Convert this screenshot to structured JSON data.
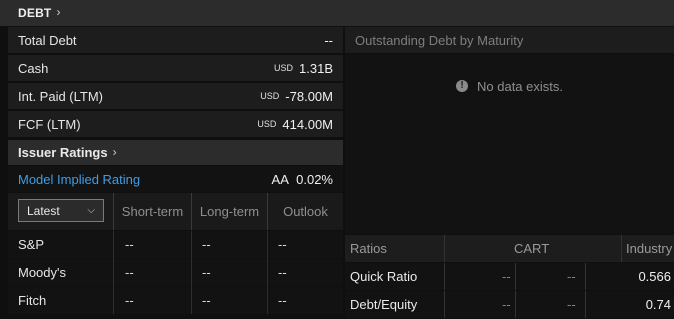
{
  "debt_header": {
    "title": "DEBT",
    "chevron": "›"
  },
  "metrics": [
    {
      "label": "Total Debt",
      "currency": "",
      "value": "--"
    },
    {
      "label": "Cash",
      "currency": "USD",
      "value": "1.31B"
    },
    {
      "label": "Int. Paid (LTM)",
      "currency": "USD",
      "value": "-78.00M"
    },
    {
      "label": "FCF (LTM)",
      "currency": "USD",
      "value": "414.00M"
    }
  ],
  "issuer_ratings": {
    "title": "Issuer Ratings",
    "chevron": "›",
    "model_implied": {
      "label": "Model Implied Rating",
      "rating": "AA",
      "pct": "0.02%"
    },
    "period_select": {
      "value": "Latest",
      "arrow": "⌵"
    },
    "columns": [
      "Short-term",
      "Long-term",
      "Outlook"
    ],
    "rows": [
      {
        "agency": "S&P",
        "short": "--",
        "long": "--",
        "outlook": "--"
      },
      {
        "agency": "Moody's",
        "short": "--",
        "long": "--",
        "outlook": "--"
      },
      {
        "agency": "Fitch",
        "short": "--",
        "long": "--",
        "outlook": "--"
      }
    ]
  },
  "outstanding_debt": {
    "title": "Outstanding Debt by Maturity",
    "empty_message": "No data exists.",
    "icon": "info-icon"
  },
  "ratios": {
    "header": {
      "label": "Ratios",
      "company": "CART",
      "industry": "Industry"
    },
    "rows": [
      {
        "name": "Quick Ratio",
        "v1": "--",
        "v2": "--",
        "industry": "0.566"
      },
      {
        "name": "Debt/Equity",
        "v1": "--",
        "v2": "--",
        "industry": "0.74"
      }
    ]
  },
  "colors": {
    "link": "#3d9ee8",
    "positive": "#2db84d",
    "header_bg": "#2c2c2c",
    "row_bg": "#1d1d1d"
  }
}
